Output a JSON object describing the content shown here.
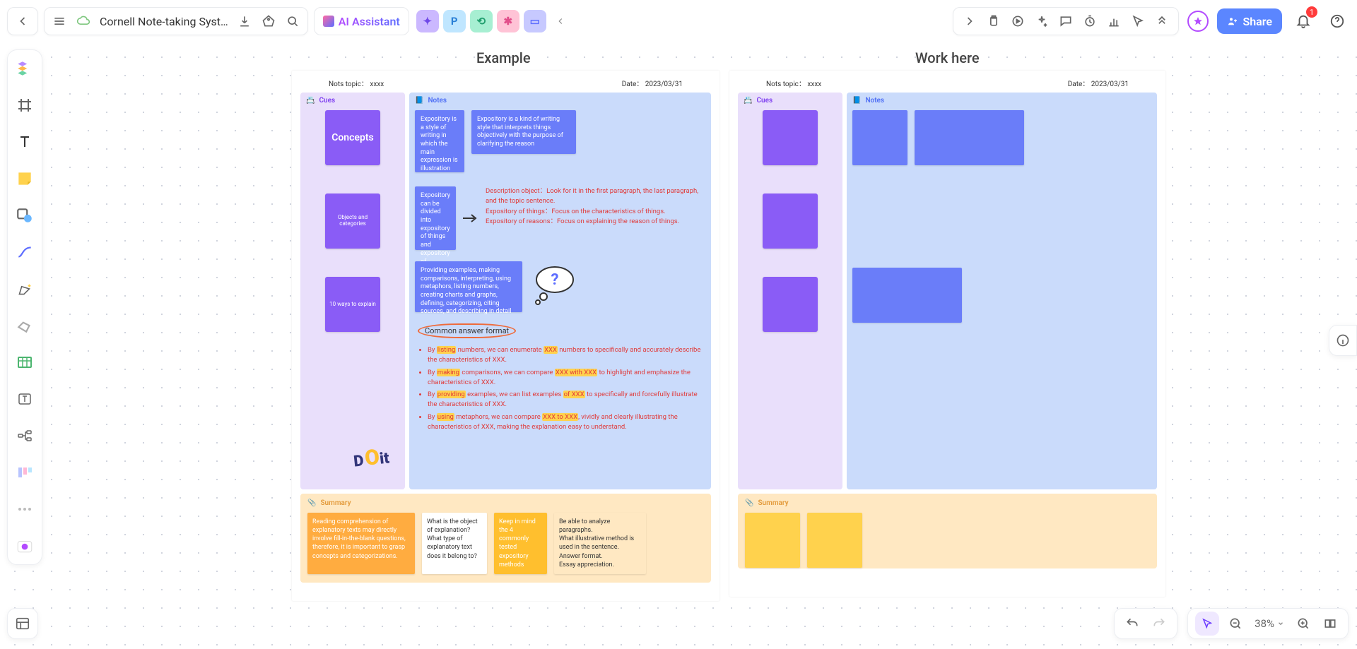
{
  "header": {
    "title": "Cornell Note-taking Syst…",
    "ai_label": "AI Assistant",
    "share_label": "Share",
    "notification_count": "1",
    "personas": [
      {
        "glyph": "✦",
        "bg": "#cbb8ff",
        "fg": "#7048e8"
      },
      {
        "glyph": "P",
        "bg": "#bfe6ff",
        "fg": "#2a7fd6"
      },
      {
        "glyph": "⟲",
        "bg": "#a7efd2",
        "fg": "#1f9e6d"
      },
      {
        "glyph": "✱",
        "bg": "#ffc3d6",
        "fg": "#e24e8a"
      },
      {
        "glyph": "▭",
        "bg": "#c7c9ff",
        "fg": "#5e6eff"
      }
    ]
  },
  "zoom": {
    "level": "38%"
  },
  "frames": {
    "example": {
      "title": "Example",
      "topic_label": "Nots topic：",
      "topic_value": "xxxx",
      "date_label": "Date：",
      "date_value": "2023/03/31",
      "headers": {
        "cues": "Cues",
        "notes": "Notes",
        "summary": "Summary"
      },
      "cues": {
        "c1": "Concepts",
        "c2": "Objects and categories",
        "c3": "10 ways to explain"
      },
      "notes": {
        "row1a": "Expository is a style of writing in which the main expression is illustration",
        "row1b": "Expository is a kind of writing style that interprets things objectively with the purpose of clarifying the reason",
        "row2a": "Expository can be divided into expository of things and expository of reasons",
        "row2b_l1": "Description object：Look for it in the first paragraph, the last paragraph, and the topic sentence.",
        "row2b_l2": "Expository of things：Focus on the characteristics of things.",
        "row2b_l3": "Expository of reasons：Focus on explaining the reason of things.",
        "row3a": "Providing examples, making comparisons, interpreting, using metaphors, listing numbers, creating charts and graphs, defining, categorizing, citing sources, and describing in detail",
        "common_fmt": "Common answer format",
        "bullets": {
          "b1a": "By ",
          "b1hl": "listing",
          "b1b": " numbers, we can enumerate ",
          "b1hl2": "XXX",
          "b1c": " numbers to specifically and accurately describe the characteristics of XXX.",
          "b2a": "By ",
          "b2hl": "making",
          "b2b": " comparisons, we can compare ",
          "b2hl2": "XXX with XXX",
          "b2c": " to highlight and emphasize the characteristics of XXX.",
          "b3a": "By ",
          "b3hl": "providing",
          "b3b": " examples, we can list examples ",
          "b3hl2": "of XXX",
          "b3c": " to specifically and forcefully illustrate the characteristics of XXX.",
          "b4a": "By ",
          "b4hl": "using",
          "b4b": " metaphors, we can compare ",
          "b4hl2": "XXX to XXX",
          "b4c": ", vividly and clearly illustrating the characteristics of XXX, making the explanation easy to understand."
        },
        "doit": "Do it"
      },
      "summary": {
        "s1": "Reading comprehension of explanatory texts may directly involve fill-in-the-blank questions, therefore, it is important to grasp concepts and categorizations.",
        "s2": "What is the object of explanation?\nWhat type of explanatory text does it belong to?",
        "s3": "Keep in mind the 4 commonly tested expository methods",
        "s4": "Be able to analyze paragraphs.\nWhat illustrative method is used in the sentence.\nAnswer format.\nEssay appreciation."
      }
    },
    "work": {
      "title": "Work here",
      "topic_label": "Nots topic：",
      "topic_value": "xxxx",
      "date_label": "Date：",
      "date_value": "2023/03/31",
      "headers": {
        "cues": "Cues",
        "notes": "Notes",
        "summary": "Summary"
      }
    }
  }
}
